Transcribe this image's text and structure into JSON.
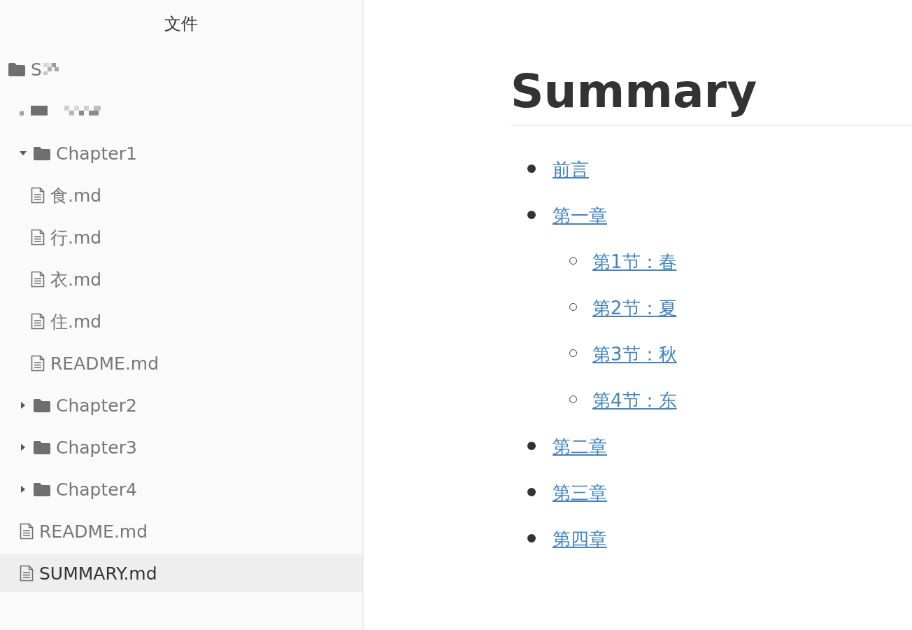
{
  "sidebar": {
    "title": "文件",
    "tree": [
      {
        "kind": "folder",
        "name": "S",
        "redacted": true,
        "selected": false,
        "children": [
          {
            "kind": "redacted",
            "selected": false
          },
          {
            "kind": "folder",
            "name": "Chapter1",
            "expanded": true,
            "selected": false,
            "children": [
              {
                "kind": "file",
                "name": "食.md",
                "selected": false
              },
              {
                "kind": "file",
                "name": "行.md",
                "selected": false
              },
              {
                "kind": "file",
                "name": "衣.md",
                "selected": false
              },
              {
                "kind": "file",
                "name": "住.md",
                "selected": false
              },
              {
                "kind": "file",
                "name": "README.md",
                "selected": false
              }
            ]
          },
          {
            "kind": "folder",
            "name": "Chapter2",
            "expanded": false,
            "selected": false
          },
          {
            "kind": "folder",
            "name": "Chapter3",
            "expanded": false,
            "selected": false
          },
          {
            "kind": "folder",
            "name": "Chapter4",
            "expanded": false,
            "selected": false
          },
          {
            "kind": "file",
            "name": "README.md",
            "selected": false
          },
          {
            "kind": "file",
            "name": "SUMMARY.md",
            "selected": true
          }
        ]
      }
    ]
  },
  "document": {
    "heading": "Summary",
    "items": [
      {
        "text": "前言"
      },
      {
        "text": "第一章",
        "children": [
          {
            "text": "第1节：春"
          },
          {
            "text": "第2节：夏"
          },
          {
            "text": "第3节：秋"
          },
          {
            "text": "第4节：东"
          }
        ]
      },
      {
        "text": "第二章"
      },
      {
        "text": "第三章"
      },
      {
        "text": "第四章"
      }
    ]
  }
}
